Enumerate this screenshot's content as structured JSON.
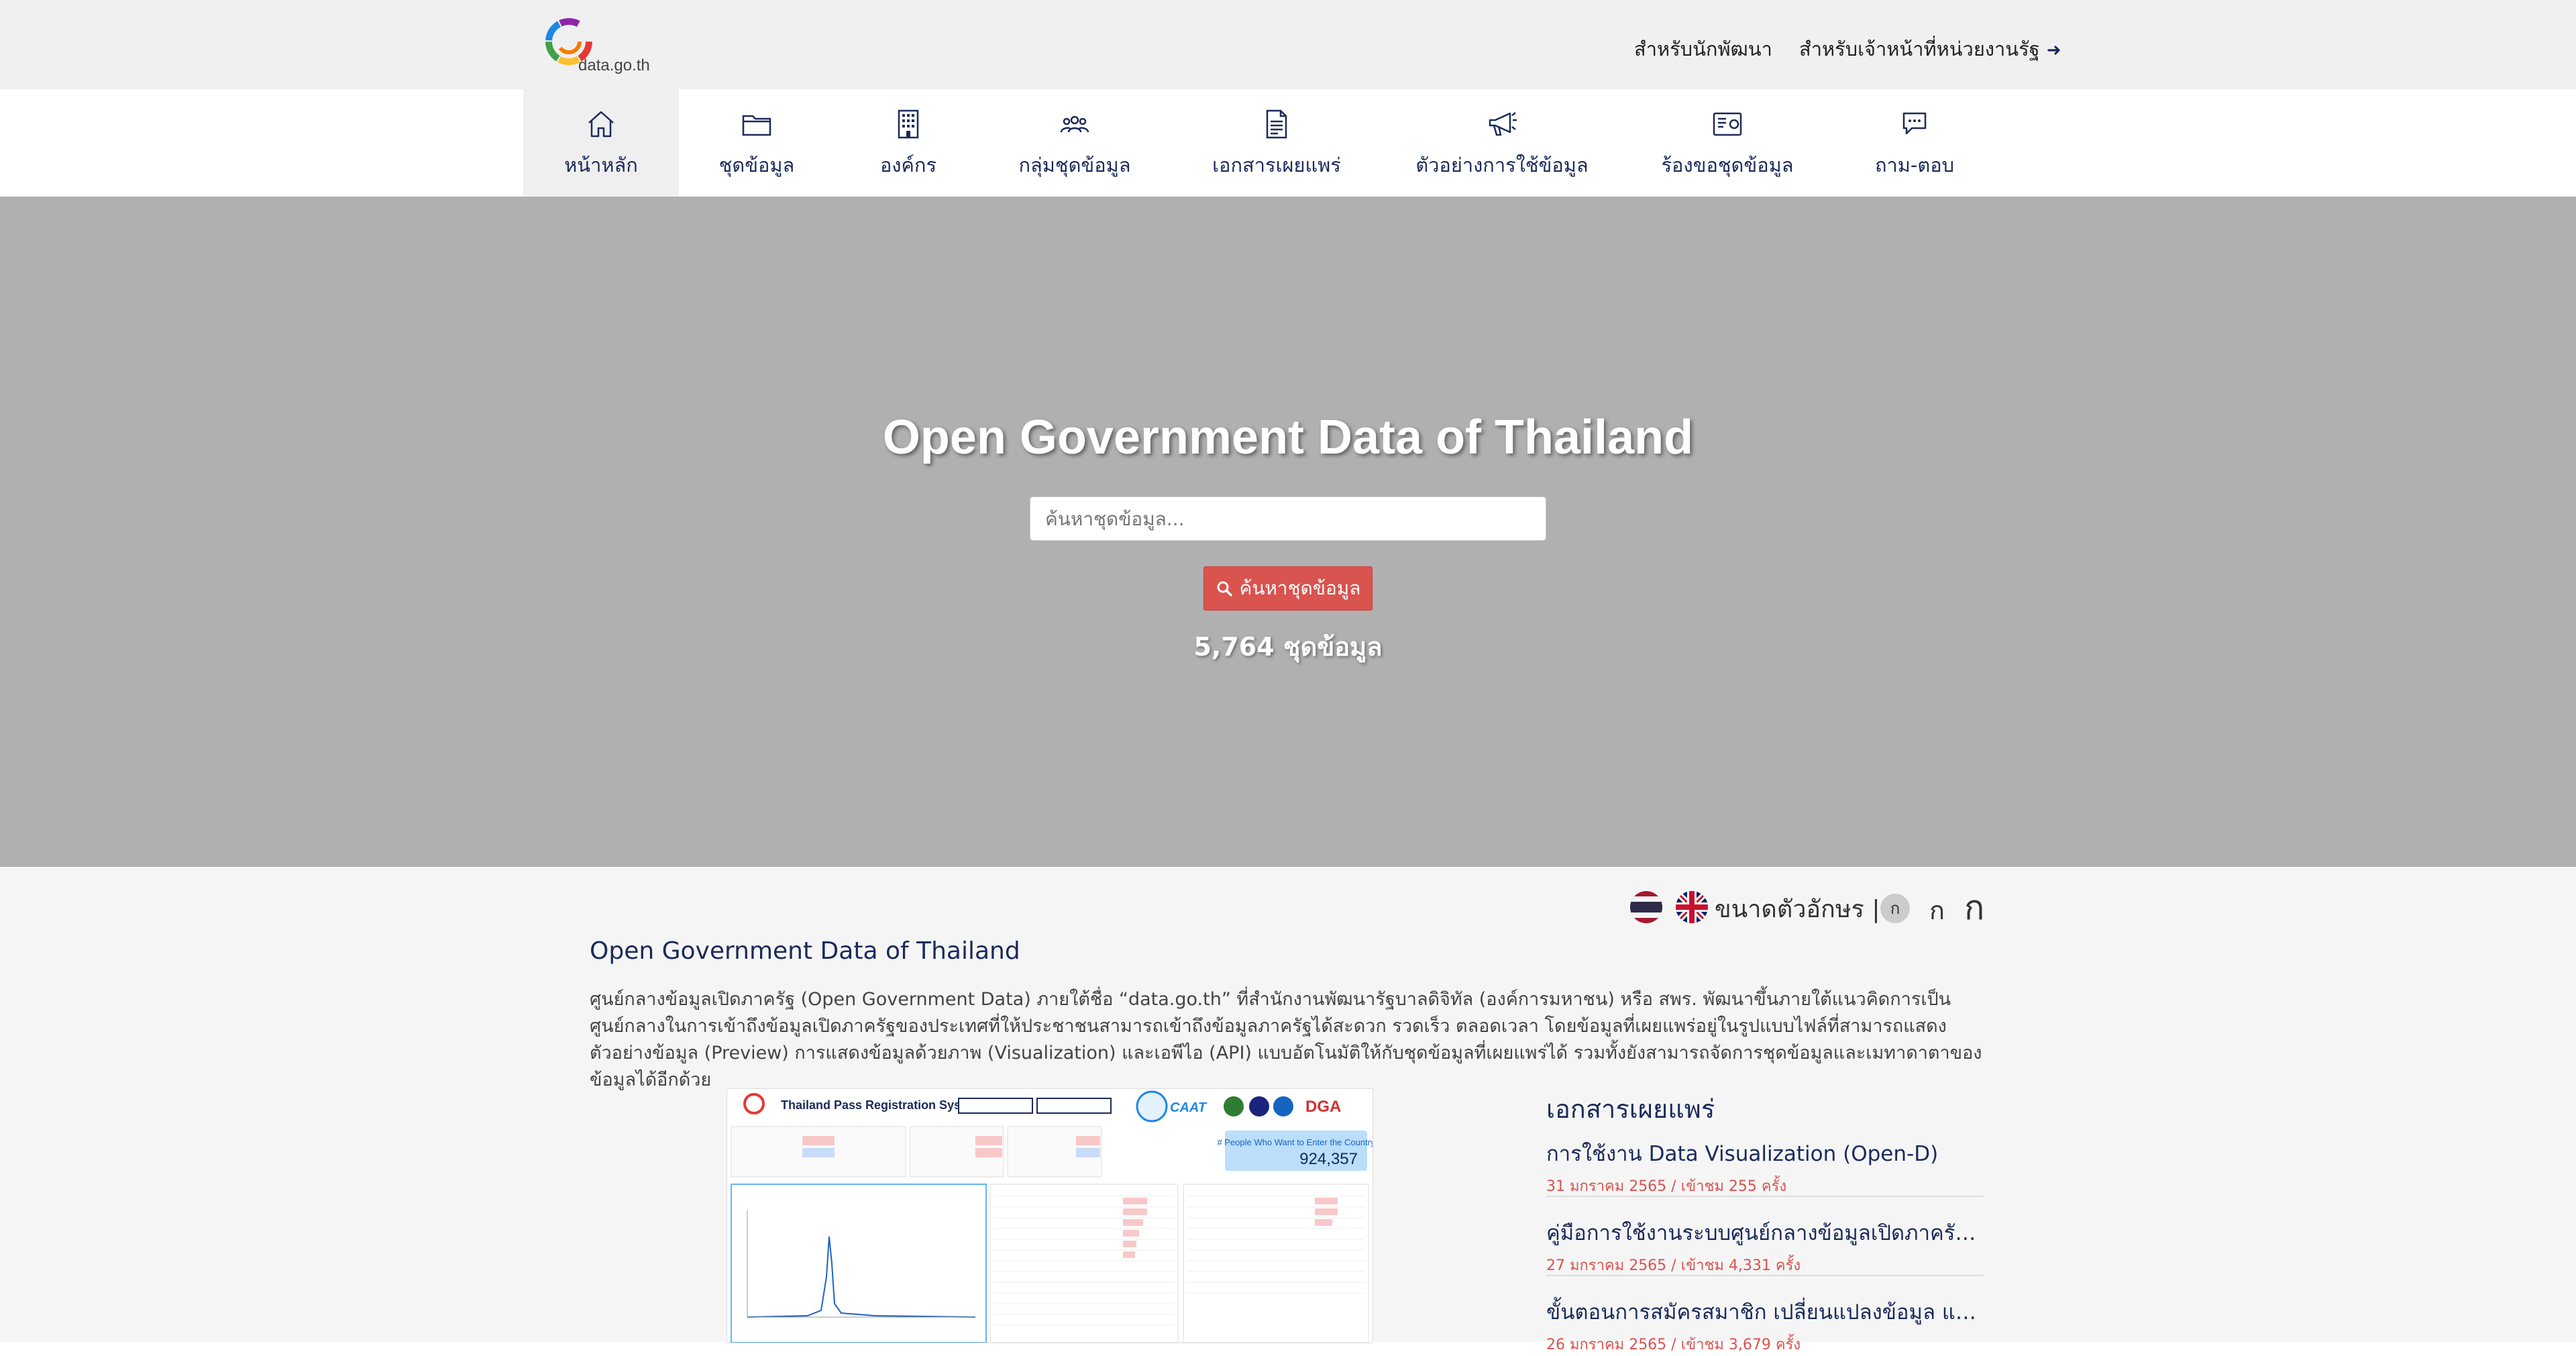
{
  "brand": {
    "logo_text": "data.go.th"
  },
  "header": {
    "developer_link": "สำหรับนักพัฒนา",
    "gov_officer_link": "สำหรับเจ้าหน้าที่หน่วยงานรัฐ"
  },
  "nav": {
    "items": [
      {
        "label": "หน้าหลัก",
        "icon": "home-icon"
      },
      {
        "label": "ชุดข้อมูล",
        "icon": "folder-icon"
      },
      {
        "label": "องค์กร",
        "icon": "building-icon"
      },
      {
        "label": "กลุ่มชุดข้อมูล",
        "icon": "users-icon"
      },
      {
        "label": "เอกสารเผยแพร่",
        "icon": "document-icon"
      },
      {
        "label": "ตัวอย่างการใช้ข้อมูล",
        "icon": "megaphone-icon"
      },
      {
        "label": "ร้องขอชุดข้อมูล",
        "icon": "request-icon"
      },
      {
        "label": "ถาม-ตอบ",
        "icon": "chat-icon"
      }
    ],
    "active_index": 0
  },
  "hero": {
    "title": "Open Government Data of Thailand",
    "search_placeholder": "ค้นหาชุดข้อมูล...",
    "search_button": "ค้นหาชุดข้อมูล",
    "dataset_count": "5,764 ชุดข้อมูล"
  },
  "font_controls": {
    "label": "ขนาดตัวอักษร |",
    "small": "ก",
    "medium": "ก",
    "large": "ก"
  },
  "about": {
    "title": "Open Government Data of Thailand",
    "text": "ศูนย์กลางข้อมูลเปิดภาครัฐ (Open Government Data) ภายใต้ชื่อ “data.go.th” ที่สำนักงานพัฒนารัฐบาลดิจิทัล (องค์การมหาชน) หรือ สพร. พัฒนาขึ้นภายใต้แนวคิดการเป็นศูนย์กลางในการเข้าถึงข้อมูลเปิดภาครัฐของประเทศที่ให้ประชาชนสามารถเข้าถึงข้อมูลภาครัฐได้สะดวก รวดเร็ว ตลอดเวลา โดยข้อมูลที่เผยแพร่อยู่ในรูปแบบไฟล์ที่สามารถแสดงตัวอย่างข้อมูล (Preview) การแสดงข้อมูลด้วยภาพ (Visualization) และเอพีไอ (API) แบบอัตโนมัติให้กับชุดข้อมูลที่เผยแพร่ได้ รวมทั้งยังสามารถจัดการชุดข้อมูลและเมทาดาตาของข้อมูลได้อีกด้วย"
  },
  "preview": {
    "title": "Thailand Pass Registration System",
    "caat": "CAAT",
    "dga": "DGA",
    "kpi_label": "# People Who Want to Enter the Country",
    "kpi_value": "924,357"
  },
  "documents": {
    "title": "เอกสารเผยแพร่",
    "items": [
      {
        "title": "การใช้งาน Data Visualization (Open-D)",
        "meta": "31 มกราคม 2565 / เข้าชม 255 ครั้ง"
      },
      {
        "title": "คู่มือการใช้งานระบบศูนย์กลางข้อมูลเปิดภาครัฐ (Dat...",
        "meta": "27 มกราคม 2565 / เข้าชม 4,331 ครั้ง"
      },
      {
        "title": "ขั้นตอนการสมัครสมาชิก เปลี่ยนแปลงข้อมูล และการ...",
        "meta": "26 มกราคม 2565 / เข้าชม 3,679 ครั้ง"
      }
    ]
  }
}
